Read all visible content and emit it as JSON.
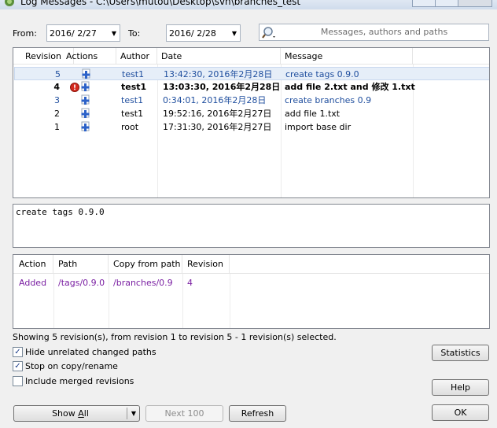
{
  "window": {
    "title": "Log Messages - C:\\Users\\mutou\\Desktop\\svn\\branches_test"
  },
  "filter": {
    "from_label": "From:",
    "from_date": "2016/  2/27",
    "to_label": "To:",
    "to_date": "2016/  2/28",
    "search_placeholder": "Messages, authors and paths"
  },
  "revisions": {
    "columns": [
      "Revision",
      "Actions",
      "Author",
      "Date",
      "Message"
    ],
    "rows": [
      {
        "revision": "5",
        "author": "test1",
        "date": "13:42:30, 2016年2月28日",
        "message": "create tags 0.9.0",
        "style": "blue",
        "selected": true,
        "actions": [
          "add"
        ]
      },
      {
        "revision": "4",
        "author": "test1",
        "date": "13:03:30, 2016年2月28日",
        "message": "add file 2.txt and 修改 1.txt",
        "style": "bold",
        "selected": false,
        "actions": [
          "modified",
          "add"
        ]
      },
      {
        "revision": "3",
        "author": "test1",
        "date": "0:34:01, 2016年2月28日",
        "message": "create branches 0.9",
        "style": "blue",
        "selected": false,
        "actions": [
          "add"
        ]
      },
      {
        "revision": "2",
        "author": "test1",
        "date": "19:52:16, 2016年2月27日",
        "message": "add file 1.txt",
        "style": "normal",
        "selected": false,
        "actions": [
          "add"
        ]
      },
      {
        "revision": "1",
        "author": "root",
        "date": "17:31:30, 2016年2月27日",
        "message": "import base dir",
        "style": "normal",
        "selected": false,
        "actions": [
          "add"
        ]
      }
    ]
  },
  "message_text": "create tags 0.9.0",
  "changed_paths": {
    "columns": [
      "Action",
      "Path",
      "Copy from path",
      "Revision"
    ],
    "rows": [
      {
        "action": "Added",
        "path": "/tags/0.9.0",
        "copy_from": "/branches/0.9",
        "revision": "4"
      }
    ]
  },
  "status_text": "Showing 5 revision(s), from revision 1 to revision 5 - 1 revision(s) selected.",
  "options": {
    "hide_unrelated": {
      "label": "Hide unrelated changed paths",
      "checked": true
    },
    "stop_on_copy": {
      "label": "Stop on copy/rename",
      "checked": true
    },
    "include_merged": {
      "label": "Include merged revisions",
      "checked": false
    }
  },
  "buttons": {
    "show_all_prefix": "Show ",
    "show_all_underlined": "A",
    "show_all_suffix": "ll",
    "next_100": "Next 100",
    "refresh": "Refresh",
    "statistics": "Statistics",
    "help": "Help",
    "ok": "OK"
  },
  "colors": {
    "link_blue": "#1f4e9e",
    "added_purple": "#7a1fa2",
    "add_icon_blue": "#2c62c8",
    "modified_icon_red": "#d42a1e"
  }
}
